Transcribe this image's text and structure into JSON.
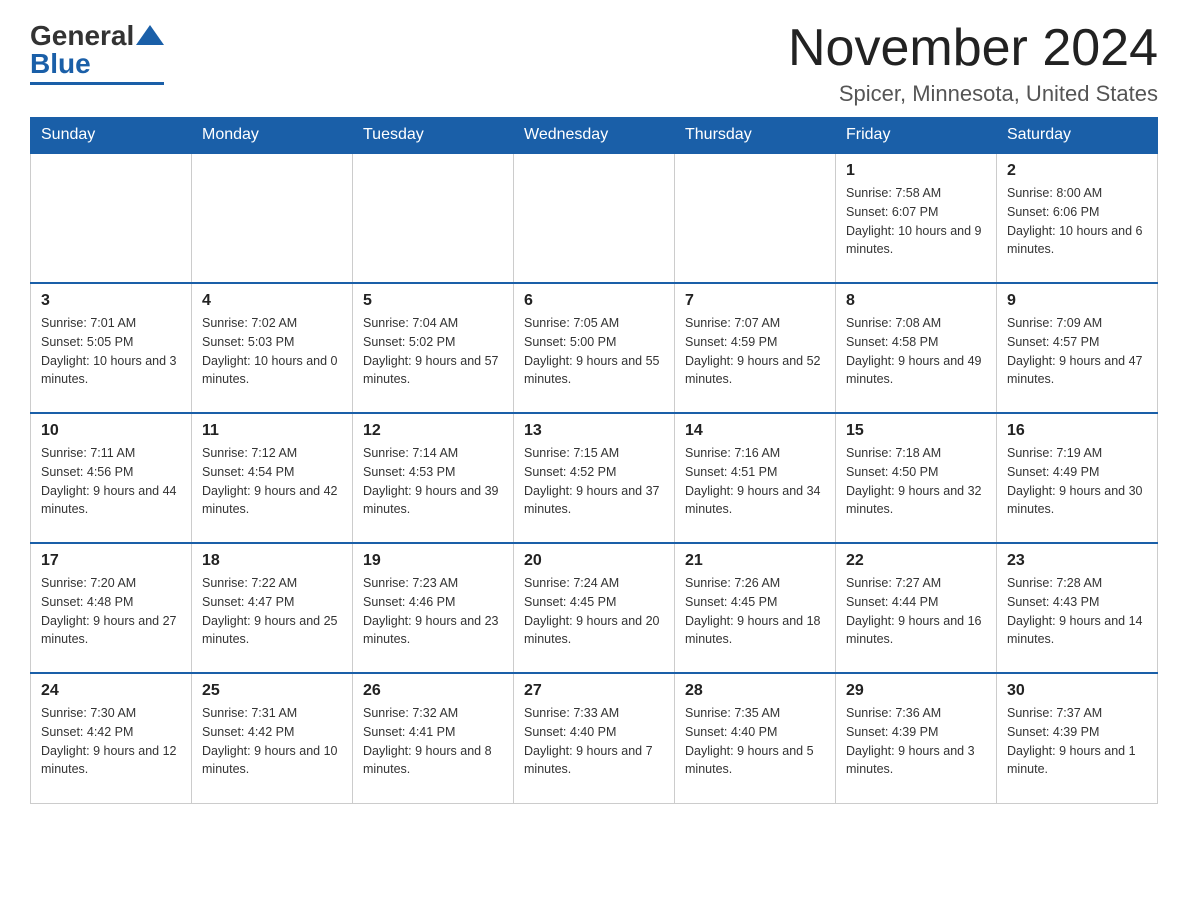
{
  "header": {
    "logo_general": "General",
    "logo_blue": "Blue",
    "month_title": "November 2024",
    "location": "Spicer, Minnesota, United States"
  },
  "days_of_week": [
    "Sunday",
    "Monday",
    "Tuesday",
    "Wednesday",
    "Thursday",
    "Friday",
    "Saturday"
  ],
  "weeks": [
    [
      {
        "day": "",
        "info": ""
      },
      {
        "day": "",
        "info": ""
      },
      {
        "day": "",
        "info": ""
      },
      {
        "day": "",
        "info": ""
      },
      {
        "day": "",
        "info": ""
      },
      {
        "day": "1",
        "info": "Sunrise: 7:58 AM\nSunset: 6:07 PM\nDaylight: 10 hours and 9 minutes."
      },
      {
        "day": "2",
        "info": "Sunrise: 8:00 AM\nSunset: 6:06 PM\nDaylight: 10 hours and 6 minutes."
      }
    ],
    [
      {
        "day": "3",
        "info": "Sunrise: 7:01 AM\nSunset: 5:05 PM\nDaylight: 10 hours and 3 minutes."
      },
      {
        "day": "4",
        "info": "Sunrise: 7:02 AM\nSunset: 5:03 PM\nDaylight: 10 hours and 0 minutes."
      },
      {
        "day": "5",
        "info": "Sunrise: 7:04 AM\nSunset: 5:02 PM\nDaylight: 9 hours and 57 minutes."
      },
      {
        "day": "6",
        "info": "Sunrise: 7:05 AM\nSunset: 5:00 PM\nDaylight: 9 hours and 55 minutes."
      },
      {
        "day": "7",
        "info": "Sunrise: 7:07 AM\nSunset: 4:59 PM\nDaylight: 9 hours and 52 minutes."
      },
      {
        "day": "8",
        "info": "Sunrise: 7:08 AM\nSunset: 4:58 PM\nDaylight: 9 hours and 49 minutes."
      },
      {
        "day": "9",
        "info": "Sunrise: 7:09 AM\nSunset: 4:57 PM\nDaylight: 9 hours and 47 minutes."
      }
    ],
    [
      {
        "day": "10",
        "info": "Sunrise: 7:11 AM\nSunset: 4:56 PM\nDaylight: 9 hours and 44 minutes."
      },
      {
        "day": "11",
        "info": "Sunrise: 7:12 AM\nSunset: 4:54 PM\nDaylight: 9 hours and 42 minutes."
      },
      {
        "day": "12",
        "info": "Sunrise: 7:14 AM\nSunset: 4:53 PM\nDaylight: 9 hours and 39 minutes."
      },
      {
        "day": "13",
        "info": "Sunrise: 7:15 AM\nSunset: 4:52 PM\nDaylight: 9 hours and 37 minutes."
      },
      {
        "day": "14",
        "info": "Sunrise: 7:16 AM\nSunset: 4:51 PM\nDaylight: 9 hours and 34 minutes."
      },
      {
        "day": "15",
        "info": "Sunrise: 7:18 AM\nSunset: 4:50 PM\nDaylight: 9 hours and 32 minutes."
      },
      {
        "day": "16",
        "info": "Sunrise: 7:19 AM\nSunset: 4:49 PM\nDaylight: 9 hours and 30 minutes."
      }
    ],
    [
      {
        "day": "17",
        "info": "Sunrise: 7:20 AM\nSunset: 4:48 PM\nDaylight: 9 hours and 27 minutes."
      },
      {
        "day": "18",
        "info": "Sunrise: 7:22 AM\nSunset: 4:47 PM\nDaylight: 9 hours and 25 minutes."
      },
      {
        "day": "19",
        "info": "Sunrise: 7:23 AM\nSunset: 4:46 PM\nDaylight: 9 hours and 23 minutes."
      },
      {
        "day": "20",
        "info": "Sunrise: 7:24 AM\nSunset: 4:45 PM\nDaylight: 9 hours and 20 minutes."
      },
      {
        "day": "21",
        "info": "Sunrise: 7:26 AM\nSunset: 4:45 PM\nDaylight: 9 hours and 18 minutes."
      },
      {
        "day": "22",
        "info": "Sunrise: 7:27 AM\nSunset: 4:44 PM\nDaylight: 9 hours and 16 minutes."
      },
      {
        "day": "23",
        "info": "Sunrise: 7:28 AM\nSunset: 4:43 PM\nDaylight: 9 hours and 14 minutes."
      }
    ],
    [
      {
        "day": "24",
        "info": "Sunrise: 7:30 AM\nSunset: 4:42 PM\nDaylight: 9 hours and 12 minutes."
      },
      {
        "day": "25",
        "info": "Sunrise: 7:31 AM\nSunset: 4:42 PM\nDaylight: 9 hours and 10 minutes."
      },
      {
        "day": "26",
        "info": "Sunrise: 7:32 AM\nSunset: 4:41 PM\nDaylight: 9 hours and 8 minutes."
      },
      {
        "day": "27",
        "info": "Sunrise: 7:33 AM\nSunset: 4:40 PM\nDaylight: 9 hours and 7 minutes."
      },
      {
        "day": "28",
        "info": "Sunrise: 7:35 AM\nSunset: 4:40 PM\nDaylight: 9 hours and 5 minutes."
      },
      {
        "day": "29",
        "info": "Sunrise: 7:36 AM\nSunset: 4:39 PM\nDaylight: 9 hours and 3 minutes."
      },
      {
        "day": "30",
        "info": "Sunrise: 7:37 AM\nSunset: 4:39 PM\nDaylight: 9 hours and 1 minute."
      }
    ]
  ]
}
